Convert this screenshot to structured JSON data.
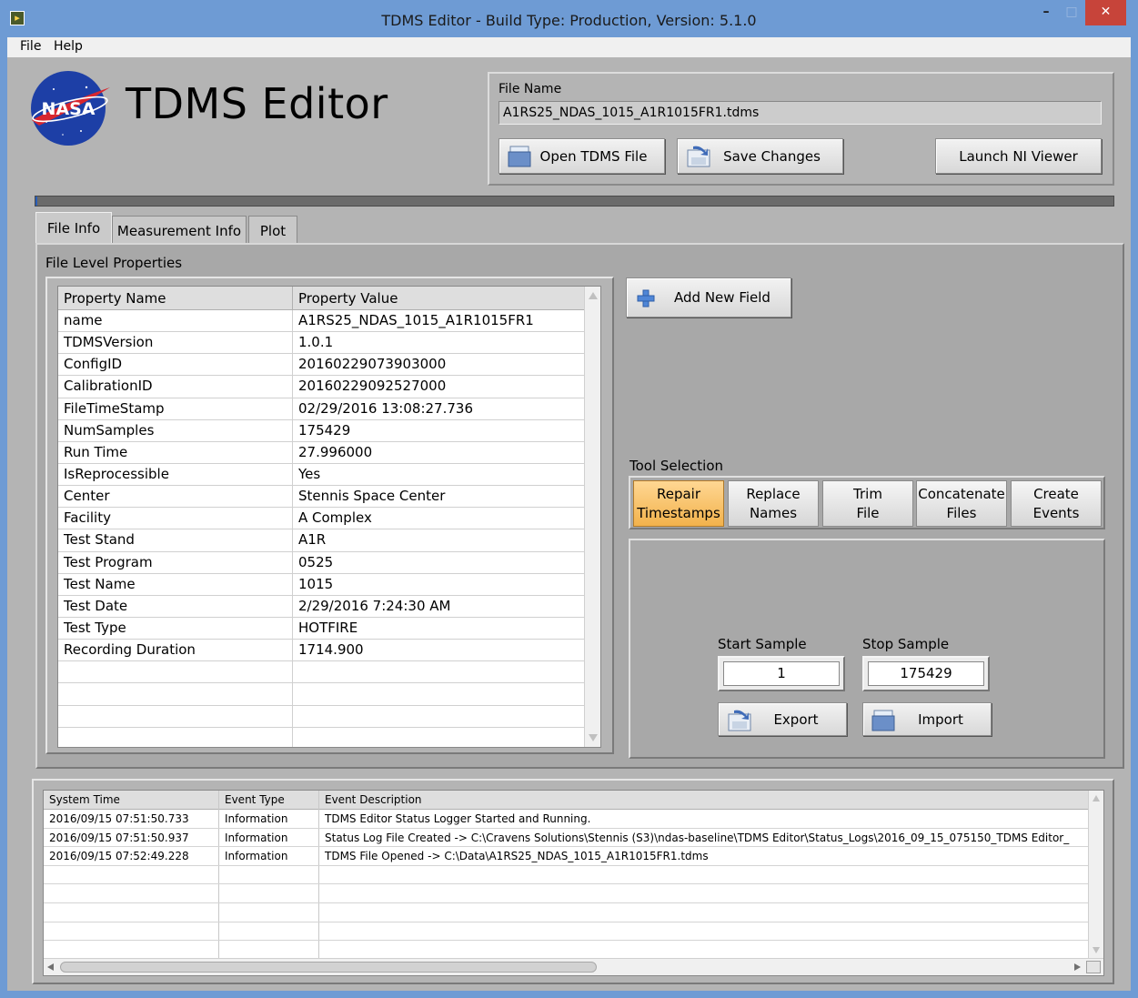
{
  "window": {
    "title": "TDMS Editor - Build Type: Production, Version: 5.1.0",
    "controls": {
      "minimize": "–",
      "maximize": "□",
      "close": "✕"
    }
  },
  "menu": {
    "file": "File",
    "help": "Help"
  },
  "header": {
    "logo_text": "NASA",
    "app_title": "TDMS Editor"
  },
  "file_box": {
    "label": "File Name",
    "value": "A1RS25_NDAS_1015_A1R1015FR1.tdms",
    "open_label": "Open TDMS File",
    "save_label": "Save Changes",
    "launch_label": "Launch NI Viewer"
  },
  "progress": {
    "value_percent": 0.2
  },
  "tabs": [
    {
      "label": "File Info",
      "active": true
    },
    {
      "label": "Measurement Info",
      "active": false
    },
    {
      "label": "Plot",
      "active": false
    }
  ],
  "file_info": {
    "section_label": "File Level Properties",
    "columns": [
      "Property Name",
      "Property Value"
    ],
    "rows": [
      [
        "name",
        "A1RS25_NDAS_1015_A1R1015FR1"
      ],
      [
        "TDMSVersion",
        "1.0.1"
      ],
      [
        "ConfigID",
        "20160229073903000"
      ],
      [
        "CalibrationID",
        "20160229092527000"
      ],
      [
        "FileTimeStamp",
        " 02/29/2016 13:08:27.736"
      ],
      [
        "NumSamples",
        "175429"
      ],
      [
        "Run Time",
        "27.996000"
      ],
      [
        "IsReprocessible",
        "Yes"
      ],
      [
        "Center",
        "Stennis Space Center"
      ],
      [
        "Facility",
        "A Complex"
      ],
      [
        "Test Stand",
        "A1R"
      ],
      [
        "Test Program",
        "0525"
      ],
      [
        "Test Name",
        "1015"
      ],
      [
        "Test Date",
        "2/29/2016 7:24:30 AM"
      ],
      [
        "Test Type",
        "HOTFIRE"
      ],
      [
        "Recording Duration",
        "1714.900"
      ],
      [
        "",
        ""
      ],
      [
        "",
        ""
      ],
      [
        "",
        ""
      ],
      [
        "",
        ""
      ]
    ],
    "add_field_label": "Add New Field"
  },
  "tools": {
    "section_label": "Tool Selection",
    "buttons": [
      {
        "line1": "Repair",
        "line2": "Timestamps",
        "active": true
      },
      {
        "line1": "Replace",
        "line2": "Names",
        "active": false
      },
      {
        "line1": "Trim",
        "line2": "File",
        "active": false
      },
      {
        "line1": "Concatenate",
        "line2": "Files",
        "active": false
      },
      {
        "line1": "Create",
        "line2": "Events",
        "active": false
      }
    ],
    "start_label": "Start Sample",
    "stop_label": "Stop Sample",
    "start_value": "1",
    "stop_value": "175429",
    "export_label": "Export",
    "import_label": "Import"
  },
  "log": {
    "columns": [
      "System Time",
      "Event Type",
      "Event Description"
    ],
    "rows": [
      [
        "2016/09/15 07:51:50.733",
        "Information",
        "TDMS Editor Status Logger Started and Running."
      ],
      [
        "2016/09/15 07:51:50.937",
        "Information",
        "Status Log File Created -> C:\\Cravens Solutions\\Stennis (S3)\\ndas-baseline\\TDMS Editor\\Status_Logs\\2016_09_15_075150_TDMS Editor_"
      ],
      [
        "2016/09/15 07:52:49.228",
        "Information",
        "TDMS File Opened -> C:\\Data\\A1RS25_NDAS_1015_A1R1015FR1.tdms"
      ],
      [
        "",
        "",
        ""
      ],
      [
        "",
        "",
        ""
      ],
      [
        "",
        "",
        ""
      ],
      [
        "",
        "",
        ""
      ],
      [
        "",
        "",
        ""
      ]
    ]
  },
  "colors": {
    "titlebar": "#6e9bd4",
    "panel": "#b4b4b4",
    "active_tool": "#f2b24c",
    "close_button": "#c7443a",
    "progress_fill": "#2a5fb8"
  }
}
